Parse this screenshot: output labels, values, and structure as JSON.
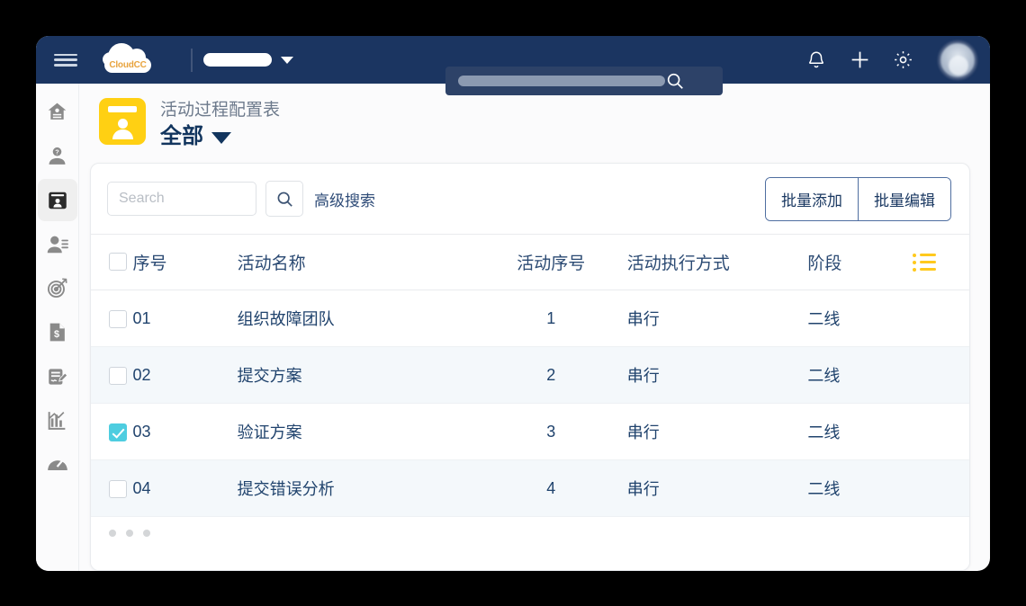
{
  "topbar": {
    "menu_icon": "hamburger-icon",
    "logo_text": "CloudCC",
    "org_value": "",
    "search_placeholder": "",
    "search_icon": "search-icon",
    "notification_icon": "bell-icon",
    "add_icon": "plus-icon",
    "settings_icon": "gear-icon",
    "avatar": "user-avatar"
  },
  "sidebar": {
    "items": [
      {
        "name": "home",
        "icon": "home-person-icon",
        "active": false
      },
      {
        "name": "leads",
        "icon": "person-question-icon",
        "active": false
      },
      {
        "name": "contacts",
        "icon": "contact-card-icon",
        "active": true
      },
      {
        "name": "accounts",
        "icon": "person-lines-icon",
        "active": false
      },
      {
        "name": "opportunities",
        "icon": "target-icon",
        "active": false
      },
      {
        "name": "quotes",
        "icon": "invoice-dollar-icon",
        "active": false
      },
      {
        "name": "contracts",
        "icon": "document-edit-icon",
        "active": false
      },
      {
        "name": "reports",
        "icon": "bar-chart-icon",
        "active": false
      },
      {
        "name": "dashboard",
        "icon": "gauge-icon",
        "active": false
      }
    ]
  },
  "page": {
    "icon": "yellow-contact-card-icon",
    "subtitle": "活动过程配置表",
    "title": "全部",
    "title_caret": "chevron-down-icon"
  },
  "toolbar": {
    "search_placeholder": "Search",
    "search_value": "",
    "search_button_icon": "search-icon",
    "advanced_search_label": "高级搜索",
    "batch_add_label": "批量添加",
    "batch_edit_label": "批量编辑"
  },
  "table": {
    "select_all_checked": false,
    "columns_menu_icon": "list-settings-icon",
    "headers": [
      "序号",
      "活动名称",
      "活动序号",
      "活动执行方式",
      "阶段"
    ],
    "rows": [
      {
        "checked": false,
        "no": "01",
        "name": "组织故障团队",
        "seq": "1",
        "exec": "串行",
        "stage": "二线"
      },
      {
        "checked": false,
        "no": "02",
        "name": "提交方案",
        "seq": "2",
        "exec": "串行",
        "stage": "二线"
      },
      {
        "checked": true,
        "no": "03",
        "name": "验证方案",
        "seq": "3",
        "exec": "串行",
        "stage": "二线"
      },
      {
        "checked": false,
        "no": "04",
        "name": "提交错误分析",
        "seq": "4",
        "exec": "串行",
        "stage": "二线"
      }
    ]
  },
  "footer": {
    "dots": 3
  },
  "colors": {
    "header_navy": "#1b3561",
    "accent_yellow": "#ffd013",
    "checkbox_cyan": "#4ecde0",
    "row_alt": "#f4f8fb",
    "text_blue": "#20436d"
  }
}
